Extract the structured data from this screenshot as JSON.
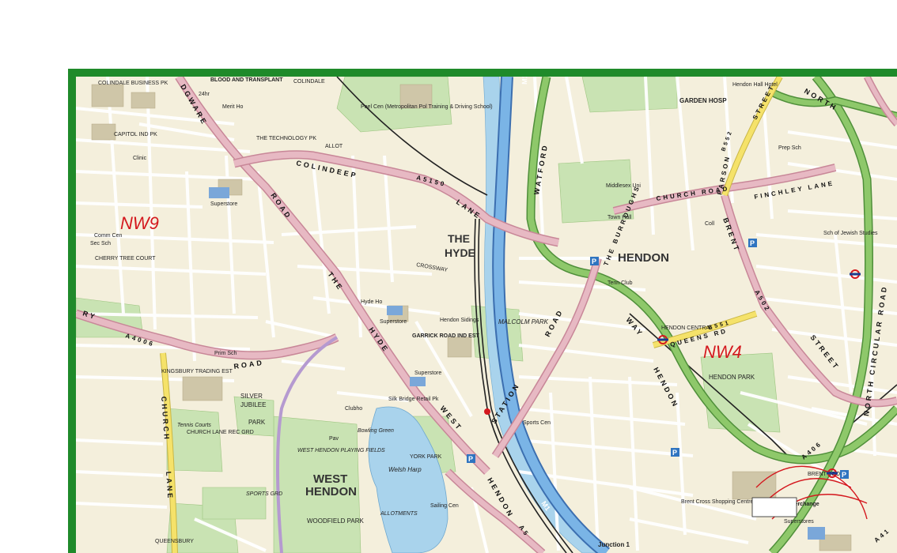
{
  "map": {
    "postcodes": [
      "NW9",
      "NW4"
    ],
    "areas": [
      "THE HYDE",
      "HENDON",
      "WEST HENDON",
      "HENDON PARK",
      "SILVER JUBILEE PARK",
      "WOODFIELD PARK",
      "COLINDALE BUSINESS PK",
      "CAPITOL IND PK",
      "KINGSBURY TRADING EST",
      "MALCOLM PARK",
      "YORK PARK",
      "GARDEN HOSP",
      "CHERRY TREE COURT",
      "WEST HENDON PLAYING FIELDS",
      "CHURCH LANE REC GRD",
      "SPORTS GRD",
      "ALLOTMENTS",
      "Welsh Harp",
      "Brent Cross Shopping Centre",
      "Brent Cross Interchange",
      "Middlesex Uni",
      "Peel Cen (Metropolitan Pol Training & Driving School)",
      "Silk Bridge Retail Pk",
      "Hendon Sidings",
      "GARRICK ROAD IND EST",
      "Junction 1",
      "BLOOD AND TRANSPLANT",
      "Sch of Jewish Studies",
      "HENDON CENTRAL",
      "BRENT CROSS",
      "Superstores",
      "COLINDALE",
      "ALLOT"
    ],
    "roads": {
      "colindeep": "COLINDEEP",
      "lane": "LANE",
      "a5150": "A5150",
      "edgware": "DGWARE",
      "road_nw": "ROAD",
      "the_hyde_1": "THE",
      "the_hyde_2": "HYDE",
      "west": "WEST",
      "hendon_station": "STATION",
      "hendon_road": "HENDON",
      "watford_way": "WATFORD",
      "way": "WAY",
      "hendon_way": "HENDON",
      "watford_road": "ROAD",
      "church_road": "CHURCH ROAD",
      "finchley_lane": "FINCHLEY LANE",
      "the_burroughs": "THE BURROUGHS",
      "brent_street": "BRENT",
      "street": "STREET",
      "a502": "A502",
      "queens_rd": "QUEENS RD",
      "b551": "B551",
      "north_circular": "NORTH CIRCULAR ROAD",
      "north": "NORTH",
      "a406": "A406",
      "a4006": "A4006",
      "ry_road": "RY",
      "road": "ROAD",
      "church_lane": "CHURCH",
      "lane2": "LANE",
      "m1": "M1",
      "a5": "A5",
      "b552": "B552",
      "parson_st": "PARSON",
      "street2": "STREET",
      "a41": "A41",
      "crossway": "CROSSWAY",
      "queensbury": "QUEENSBURY"
    },
    "pois": [
      "Superstore",
      "Superstore",
      "Superstore",
      "Sports Cen",
      "Comm Cen",
      "Clinic",
      "Prim Sch",
      "Sec Sch",
      "Tenn Club",
      "Town Hall",
      "Hyde Ho",
      "Clubho",
      "Pav",
      "Bowling Green",
      "Sailing Cen",
      "Tennis Courts",
      "Merit Ho",
      "THE TECHNOLOGY PK",
      "Hendon Hall Hotel",
      "Prep Sch",
      "Coll",
      "24hr",
      "Superstores",
      "Hosp"
    ],
    "colors": {
      "border": "#1f8a2a",
      "background": "#f4efdc",
      "park": "#c9e3b3",
      "water": "#a9d3ec",
      "motorway": "#7ab4e6",
      "a_road": "#e7b9c3",
      "green_road": "#8ec86a",
      "b_road": "#f5e26a",
      "rail": "#222222",
      "postcode_label": "#d4181e"
    }
  }
}
